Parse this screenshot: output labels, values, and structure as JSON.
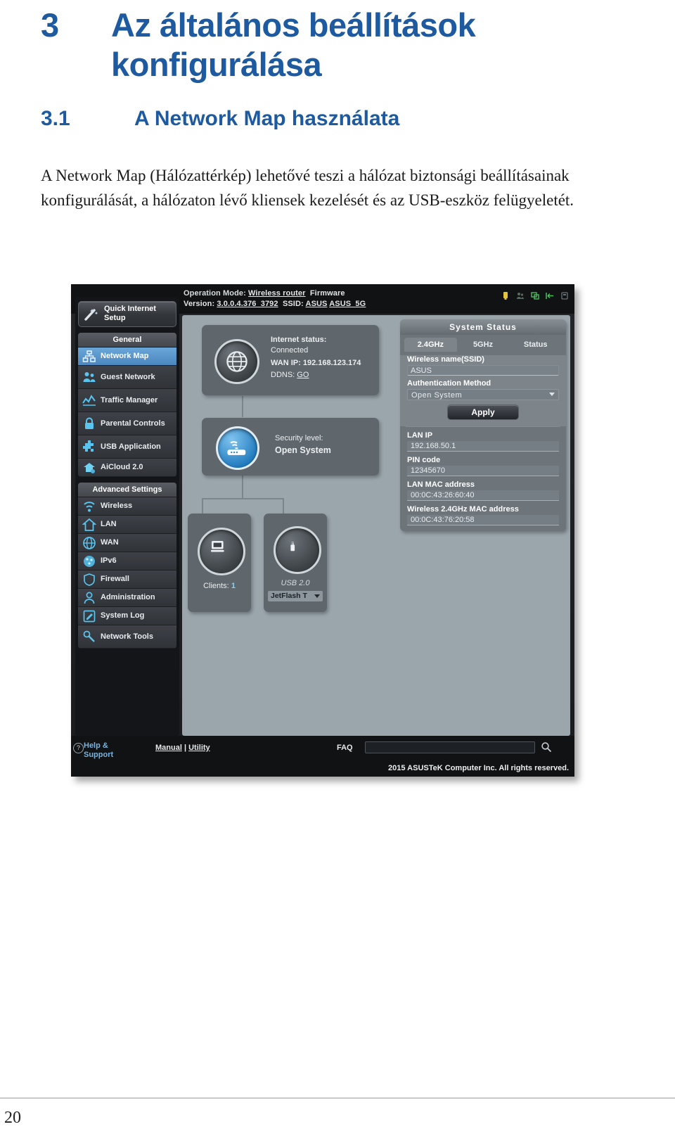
{
  "document": {
    "chapter_number": "3",
    "chapter_title_line1": "Az általános beállítások",
    "chapter_title_line2": "konfigurálása",
    "section_number": "3.1",
    "section_title": "A Network Map használata",
    "paragraph": "A Network Map (Hálózattérkép) lehetővé teszi a hálózat biztonsági beállításainak konfigurálását, a hálózaton lévő kliensek kezelését és az USB-eszköz felügyeletét.",
    "page_number": "20"
  },
  "router_ui": {
    "topbar": {
      "operation_mode_label": "Operation Mode:",
      "operation_mode_value": "Wireless router",
      "firmware_label": "Firmware",
      "version_label": "Version:",
      "version_value": "3.0.0.4.376_3792",
      "ssid_label": "SSID:",
      "ssid_value_1": "ASUS",
      "ssid_value_2": "ASUS_5G",
      "icons": [
        "usb-status-icon",
        "guest-network-icon",
        "clients-icon",
        "connection-icon",
        "reboot-icon"
      ]
    },
    "sidebar": {
      "quick_setup": {
        "line1": "Quick Internet",
        "line2": "Setup",
        "icon": "wand-icon"
      },
      "groups": [
        {
          "title": "General",
          "items": [
            {
              "label": "Network Map",
              "icon": "network-map-icon",
              "selected": true
            },
            {
              "label": "Guest Network",
              "icon": "guest-network-icon",
              "selected": false
            },
            {
              "label": "Traffic Manager",
              "icon": "traffic-chart-icon",
              "selected": false
            },
            {
              "label": "Parental Controls",
              "icon": "lock-icon",
              "selected": false
            },
            {
              "label": "USB Application",
              "icon": "usb-app-icon",
              "selected": false
            },
            {
              "label": "AiCloud 2.0",
              "icon": "cloud-icon",
              "selected": false
            }
          ]
        },
        {
          "title": "Advanced Settings",
          "items": [
            {
              "label": "Wireless",
              "icon": "wifi-icon",
              "selected": false
            },
            {
              "label": "LAN",
              "icon": "home-icon",
              "selected": false
            },
            {
              "label": "WAN",
              "icon": "globe-icon",
              "selected": false
            },
            {
              "label": "IPv6",
              "icon": "ipv6-globe-icon",
              "selected": false
            },
            {
              "label": "Firewall",
              "icon": "shield-icon",
              "selected": false
            },
            {
              "label": "Administration",
              "icon": "user-icon",
              "selected": false
            },
            {
              "label": "System Log",
              "icon": "log-pencil-icon",
              "selected": false
            },
            {
              "label": "Network Tools",
              "icon": "wrench-icon",
              "selected": false
            }
          ]
        }
      ]
    },
    "internet_card": {
      "status_label": "Internet status:",
      "status_value": "Connected",
      "wan_ip": "WAN IP: 192.168.123.174",
      "ddns_label": "DDNS:",
      "ddns_value": "GO",
      "icon": "globe-icon"
    },
    "security_card": {
      "label": "Security level:",
      "value": "Open System",
      "icon": "router-signal-icon"
    },
    "clients_card": {
      "label": "Clients:",
      "count": "1",
      "icon": "monitor-icon"
    },
    "usb_card": {
      "label": "USB 2.0",
      "device": "JetFlash T",
      "icon": "usb-drive-icon"
    },
    "system_status": {
      "title": "System Status",
      "tabs": [
        {
          "label": "2.4GHz",
          "active": true
        },
        {
          "label": "5GHz",
          "active": false
        },
        {
          "label": "Status",
          "active": false
        }
      ],
      "ssid_label": "Wireless name(SSID)",
      "ssid_value": "ASUS",
      "auth_label": "Authentication Method",
      "auth_value": "Open System",
      "apply_label": "Apply",
      "fields": [
        {
          "label": "LAN IP",
          "value": "192.168.50.1"
        },
        {
          "label": "PIN code",
          "value": "12345670"
        },
        {
          "label": "LAN MAC address",
          "value": "00:0C:43:26:60:40"
        },
        {
          "label": "Wireless 2.4GHz MAC address",
          "value": "00:0C:43:76:20:58"
        }
      ]
    },
    "footer": {
      "help_line1": "Help &",
      "help_line2": "Support",
      "question_mark": "?",
      "manual": "Manual",
      "separator": "|",
      "utility": "Utility",
      "faq": "FAQ",
      "copyright": "2015 ASUSTeK Computer Inc. All rights reserved.",
      "search_icon": "search-icon"
    }
  }
}
